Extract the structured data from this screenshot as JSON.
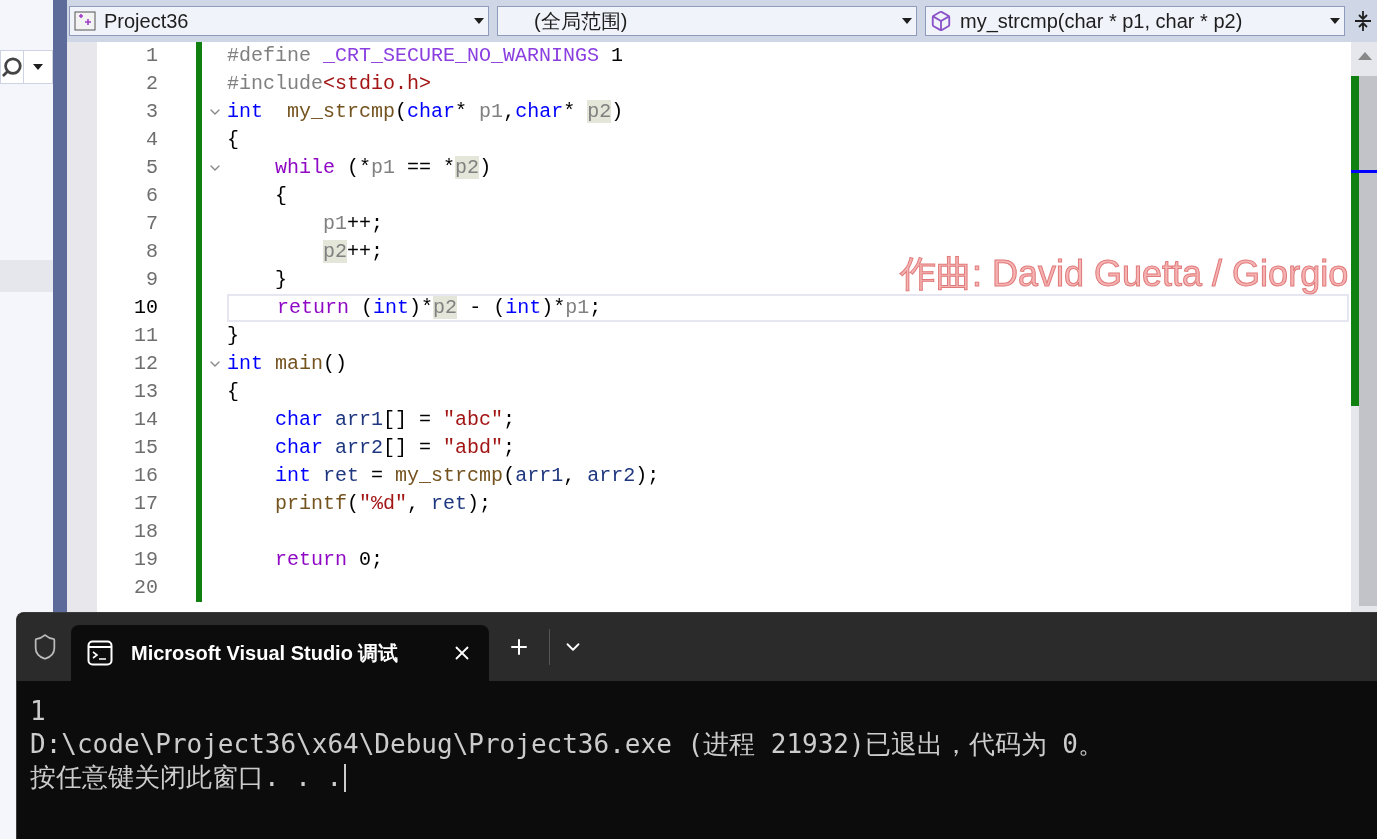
{
  "nav_bar": {
    "project": "Project36",
    "scope": "(全局范围)",
    "member": "my_strcmp(char * p1, char * p2)"
  },
  "editor": {
    "lines": [
      {
        "number": "1",
        "current": false,
        "foldable": false,
        "tokens": [
          {
            "kind": "preprocessor",
            "text": "#define "
          },
          {
            "kind": "macro",
            "text": "_CRT_SECURE_NO_WARNINGS"
          },
          {
            "kind": "plain",
            "text": " 1"
          }
        ]
      },
      {
        "number": "2",
        "current": false,
        "foldable": false,
        "tokens": [
          {
            "kind": "preprocessor",
            "text": "#include"
          },
          {
            "kind": "string",
            "text": "<stdio.h>"
          }
        ]
      },
      {
        "number": "3",
        "current": false,
        "foldable": true,
        "tokens": [
          {
            "kind": "keyword",
            "text": "int"
          },
          {
            "kind": "function",
            "text": "  my_strcmp"
          },
          {
            "kind": "plain",
            "text": "("
          },
          {
            "kind": "keyword",
            "text": "char"
          },
          {
            "kind": "plain",
            "text": "* "
          },
          {
            "kind": "param",
            "text": "p1"
          },
          {
            "kind": "plain",
            "text": ","
          },
          {
            "kind": "keyword",
            "text": "char"
          },
          {
            "kind": "plain",
            "text": "* "
          },
          {
            "kind": "param_ref",
            "text": "p2"
          },
          {
            "kind": "plain",
            "text": ")"
          }
        ]
      },
      {
        "number": "4",
        "current": false,
        "foldable": false,
        "tokens": [
          {
            "kind": "plain",
            "text": "{"
          }
        ]
      },
      {
        "number": "5",
        "current": false,
        "foldable": true,
        "tokens": [
          {
            "kind": "control",
            "text": "    while"
          },
          {
            "kind": "plain",
            "text": " (*"
          },
          {
            "kind": "param",
            "text": "p1"
          },
          {
            "kind": "plain",
            "text": " == *"
          },
          {
            "kind": "param_ref",
            "text": "p2"
          },
          {
            "kind": "plain",
            "text": ")"
          }
        ]
      },
      {
        "number": "6",
        "current": false,
        "foldable": false,
        "tokens": [
          {
            "kind": "plain",
            "text": "    {"
          }
        ]
      },
      {
        "number": "7",
        "current": false,
        "foldable": false,
        "tokens": [
          {
            "kind": "param",
            "text": "        p1"
          },
          {
            "kind": "plain",
            "text": "++;"
          }
        ]
      },
      {
        "number": "8",
        "current": false,
        "foldable": false,
        "tokens": [
          {
            "kind": "param_ref",
            "text": "        p2"
          },
          {
            "kind": "plain",
            "text": "++;"
          }
        ]
      },
      {
        "number": "9",
        "current": false,
        "foldable": false,
        "tokens": [
          {
            "kind": "plain",
            "text": "    }"
          }
        ]
      },
      {
        "number": "10",
        "current": true,
        "foldable": false,
        "tokens": [
          {
            "kind": "control",
            "text": "    return"
          },
          {
            "kind": "plain",
            "text": " ("
          },
          {
            "kind": "keyword",
            "text": "int"
          },
          {
            "kind": "plain",
            "text": ")*"
          },
          {
            "kind": "param_ref",
            "text": "p2"
          },
          {
            "kind": "plain",
            "text": " - ("
          },
          {
            "kind": "keyword",
            "text": "int"
          },
          {
            "kind": "plain",
            "text": ")*"
          },
          {
            "kind": "param",
            "text": "p1"
          },
          {
            "kind": "plain",
            "text": ";"
          }
        ]
      },
      {
        "number": "11",
        "current": false,
        "foldable": false,
        "tokens": [
          {
            "kind": "plain",
            "text": "}"
          }
        ]
      },
      {
        "number": "12",
        "current": false,
        "foldable": true,
        "tokens": [
          {
            "kind": "keyword",
            "text": "int"
          },
          {
            "kind": "function",
            "text": " main"
          },
          {
            "kind": "plain",
            "text": "()"
          }
        ]
      },
      {
        "number": "13",
        "current": false,
        "foldable": false,
        "tokens": [
          {
            "kind": "plain",
            "text": "{"
          }
        ]
      },
      {
        "number": "14",
        "current": false,
        "foldable": false,
        "tokens": [
          {
            "kind": "keyword",
            "text": "    char"
          },
          {
            "kind": "local",
            "text": " arr1"
          },
          {
            "kind": "plain",
            "text": "[] = "
          },
          {
            "kind": "string",
            "text": "\"abc\""
          },
          {
            "kind": "plain",
            "text": ";"
          }
        ]
      },
      {
        "number": "15",
        "current": false,
        "foldable": false,
        "tokens": [
          {
            "kind": "keyword",
            "text": "    char"
          },
          {
            "kind": "local",
            "text": " arr2"
          },
          {
            "kind": "plain",
            "text": "[] = "
          },
          {
            "kind": "string",
            "text": "\"abd\""
          },
          {
            "kind": "plain",
            "text": ";"
          }
        ]
      },
      {
        "number": "16",
        "current": false,
        "foldable": false,
        "tokens": [
          {
            "kind": "keyword",
            "text": "    int"
          },
          {
            "kind": "local",
            "text": " ret"
          },
          {
            "kind": "plain",
            "text": " = "
          },
          {
            "kind": "function",
            "text": "my_strcmp"
          },
          {
            "kind": "plain",
            "text": "("
          },
          {
            "kind": "local",
            "text": "arr1"
          },
          {
            "kind": "plain",
            "text": ", "
          },
          {
            "kind": "local",
            "text": "arr2"
          },
          {
            "kind": "plain",
            "text": ");"
          }
        ]
      },
      {
        "number": "17",
        "current": false,
        "foldable": false,
        "tokens": [
          {
            "kind": "function",
            "text": "    printf"
          },
          {
            "kind": "plain",
            "text": "("
          },
          {
            "kind": "string",
            "text": "\"%d\""
          },
          {
            "kind": "plain",
            "text": ", "
          },
          {
            "kind": "local",
            "text": "ret"
          },
          {
            "kind": "plain",
            "text": ");"
          }
        ]
      },
      {
        "number": "18",
        "current": false,
        "foldable": false
      },
      {
        "number": "19",
        "current": false,
        "foldable": false,
        "tokens": [
          {
            "kind": "control",
            "text": "    return"
          },
          {
            "kind": "plain",
            "text": " 0;"
          }
        ]
      },
      {
        "number": "20",
        "current": false,
        "foldable": false
      }
    ]
  },
  "lyrics_overlay": {
    "text": "作曲: David Guetta / Giorgio"
  },
  "terminal": {
    "tab": {
      "title": "Microsoft Visual Studio 调试",
      "selected": true
    },
    "output": [
      "1",
      "D:\\code\\Project36\\x64\\Debug\\Project36.exe (进程 21932)已退出，代码为 0。",
      "按任意键关闭此窗口. . ."
    ]
  }
}
